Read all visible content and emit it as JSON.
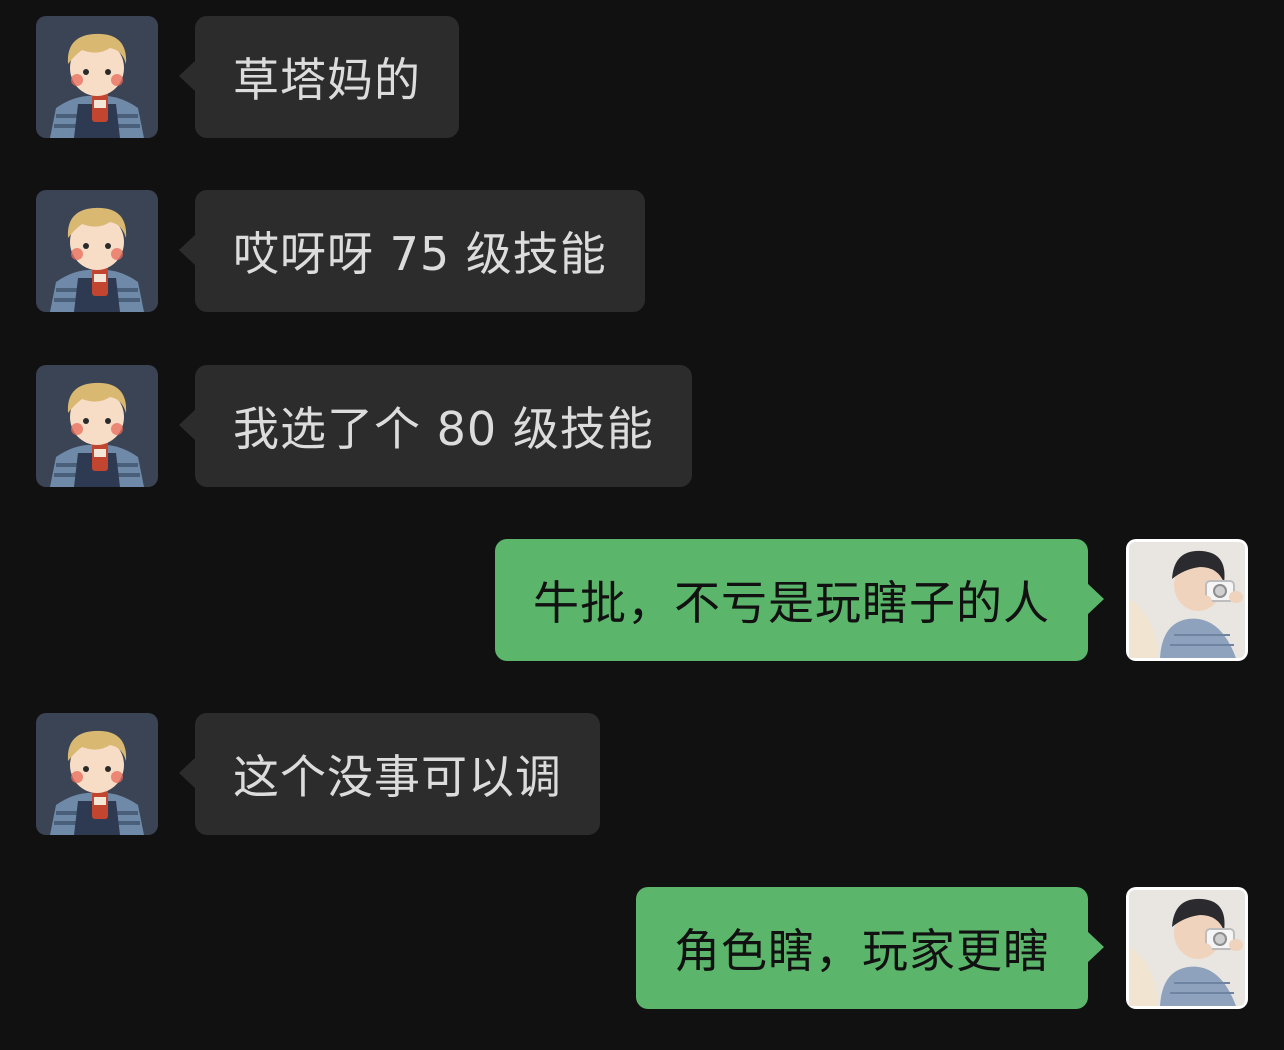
{
  "colors": {
    "background": "#111111",
    "incoming_bubble": "#2c2c2c",
    "incoming_text": "#dcdcdc",
    "outgoing_bubble": "#5bb66b",
    "outgoing_text": "#111111"
  },
  "contacts": {
    "other": {
      "avatar_icon": "cartoon-boy-avatar-icon"
    },
    "self": {
      "avatar_icon": "photo-boy-camera-avatar-icon"
    }
  },
  "messages": [
    {
      "sender": "other",
      "text": "草塔妈的"
    },
    {
      "sender": "other",
      "text": "哎呀呀 75 级技能"
    },
    {
      "sender": "other",
      "text": "我选了个 80 级技能"
    },
    {
      "sender": "self",
      "text": "牛批，不亏是玩瞎子的人"
    },
    {
      "sender": "other",
      "text": "这个没事可以调"
    },
    {
      "sender": "self",
      "text": "角色瞎，玩家更瞎"
    }
  ]
}
